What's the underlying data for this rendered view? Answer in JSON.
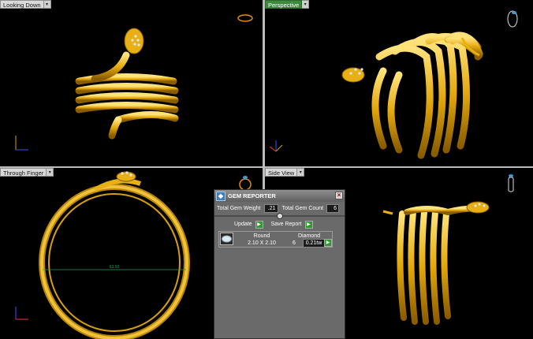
{
  "viewports": {
    "top_left": {
      "label": "Looking Down"
    },
    "top_right": {
      "label": "Perspective"
    },
    "bottom_left": {
      "label": "Through Finger",
      "measurement": "63.50"
    },
    "bottom_right": {
      "label": "Side View"
    }
  },
  "gem_reporter": {
    "title": "GEM REPORTER",
    "total_gem_weight_label": "Total Gem Weight",
    "total_gem_weight_value": ".21",
    "total_gem_count_label": "Total Gem Count",
    "total_gem_count_value": "6",
    "update_label": "Update",
    "save_report_label": "Save Report",
    "table": {
      "shape": "Round",
      "size": "2.10 X 2.10",
      "material": "Diamond",
      "count": "6",
      "weight": "0.21tw"
    }
  },
  "colors": {
    "gold": "#e8b014",
    "active_viewport": "#3c8a3c",
    "panel": "#6a6a6a"
  }
}
